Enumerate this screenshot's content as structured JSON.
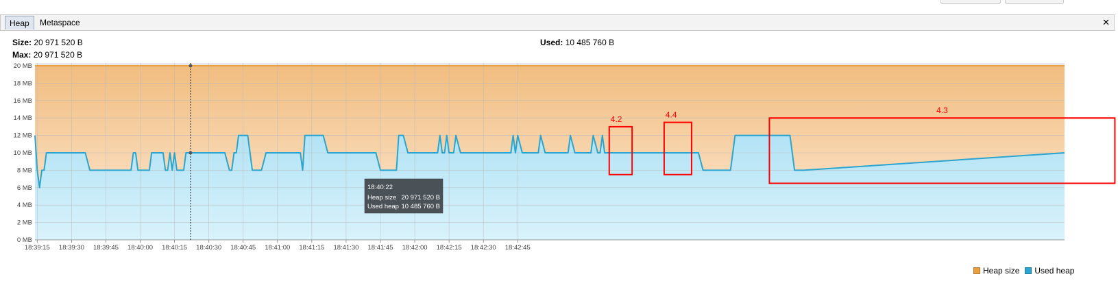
{
  "tabs": [
    {
      "label": "Heap",
      "active": true
    },
    {
      "label": "Metaspace",
      "active": false
    }
  ],
  "info": {
    "size_label": "Size:",
    "size_value": "20 971 520 B",
    "max_label": "Max:",
    "max_value": "20 971 520 B",
    "used_label": "Used:",
    "used_value": "10 485 760 B"
  },
  "colors": {
    "heap_size": "#e8a040",
    "used_heap": "#2aa5cf",
    "annotation": "#ff0000",
    "tooltip_bg": "#4a5157"
  },
  "tooltip": {
    "time": "18:40:22",
    "rows": [
      {
        "label": "Heap size",
        "value": "20 971 520 B"
      },
      {
        "label": "Used heap",
        "value": "10 485 760 B"
      }
    ]
  },
  "annotations": [
    {
      "label": "4.2",
      "x_start": 250,
      "x_end": 260,
      "y_low": 7.5,
      "y_high": 13.0
    },
    {
      "label": "4.4",
      "x_start": 274,
      "x_end": 286,
      "y_low": 7.5,
      "y_high": 13.5
    },
    {
      "label": "4.3",
      "x_start": 320,
      "x_end": 471,
      "y_low": 6.5,
      "y_high": 14.0
    }
  ],
  "chart_data": {
    "type": "area",
    "x_unit": "seconds after 18:39:15",
    "x_ticks": [
      "18:39:15",
      "18:39:30",
      "18:39:45",
      "18:40:00",
      "18:40:15",
      "18:40:30",
      "18:40:45",
      "18:41:00",
      "18:41:15",
      "18:41:30",
      "18:41:45",
      "18:42:00",
      "18:42:15",
      "18:42:30",
      "18:42:45"
    ],
    "y_ticks": [
      "0 MB",
      "2 MB",
      "4 MB",
      "6 MB",
      "8 MB",
      "10 MB",
      "12 MB",
      "14 MB",
      "16 MB",
      "18 MB",
      "20 MB"
    ],
    "ylim": [
      0,
      20
    ],
    "xlim": [
      -1,
      449
    ],
    "grid": true,
    "legend_position": "bottom-right",
    "cursor_x": 67,
    "series": [
      {
        "name": "Heap size",
        "points": [
          [
            -1,
            20
          ],
          [
            449,
            20
          ]
        ]
      },
      {
        "name": "Used heap",
        "points": [
          [
            -1,
            12
          ],
          [
            0,
            8
          ],
          [
            1,
            6
          ],
          [
            2,
            8
          ],
          [
            3,
            8
          ],
          [
            4,
            10
          ],
          [
            21,
            10
          ],
          [
            23,
            8
          ],
          [
            41,
            8
          ],
          [
            42,
            10
          ],
          [
            43,
            10
          ],
          [
            44,
            8
          ],
          [
            49,
            8
          ],
          [
            50,
            10
          ],
          [
            55,
            10
          ],
          [
            56,
            8
          ],
          [
            57,
            8
          ],
          [
            58,
            10
          ],
          [
            59,
            8
          ],
          [
            60,
            10
          ],
          [
            61,
            8
          ],
          [
            64,
            8
          ],
          [
            65,
            10
          ],
          [
            82,
            10
          ],
          [
            84,
            8
          ],
          [
            85,
            8
          ],
          [
            86,
            10
          ],
          [
            87,
            10
          ],
          [
            88,
            12
          ],
          [
            92,
            12
          ],
          [
            94,
            8
          ],
          [
            98,
            8
          ],
          [
            100,
            10
          ],
          [
            115,
            10
          ],
          [
            116,
            8
          ],
          [
            117,
            12
          ],
          [
            125,
            12
          ],
          [
            127,
            10
          ],
          [
            148,
            10
          ],
          [
            150,
            8
          ],
          [
            157,
            8
          ],
          [
            158,
            12
          ],
          [
            160,
            12
          ],
          [
            162,
            10
          ],
          [
            175,
            10
          ],
          [
            176,
            12
          ],
          [
            177,
            10
          ],
          [
            178,
            10
          ],
          [
            179,
            12
          ],
          [
            180,
            10
          ],
          [
            182,
            10
          ],
          [
            183,
            12
          ],
          [
            185,
            10
          ],
          [
            207,
            10
          ],
          [
            208,
            12
          ],
          [
            209,
            10
          ],
          [
            210,
            12
          ],
          [
            212,
            10
          ],
          [
            219,
            10
          ],
          [
            220,
            12
          ],
          [
            222,
            10
          ],
          [
            232,
            10
          ],
          [
            233,
            12
          ],
          [
            235,
            10
          ],
          [
            242,
            10
          ],
          [
            243,
            12
          ],
          [
            245,
            10
          ],
          [
            246,
            10
          ],
          [
            247,
            12
          ],
          [
            248,
            10
          ],
          [
            289,
            10
          ],
          [
            291,
            8
          ],
          [
            303,
            8
          ],
          [
            305,
            12
          ],
          [
            329,
            12
          ],
          [
            331,
            8
          ],
          [
            335,
            8
          ],
          [
            449,
            10
          ]
        ]
      }
    ]
  },
  "legend": [
    {
      "label": "Heap size",
      "color": "#e8a040"
    },
    {
      "label": "Used heap",
      "color": "#2aa5cf"
    }
  ]
}
